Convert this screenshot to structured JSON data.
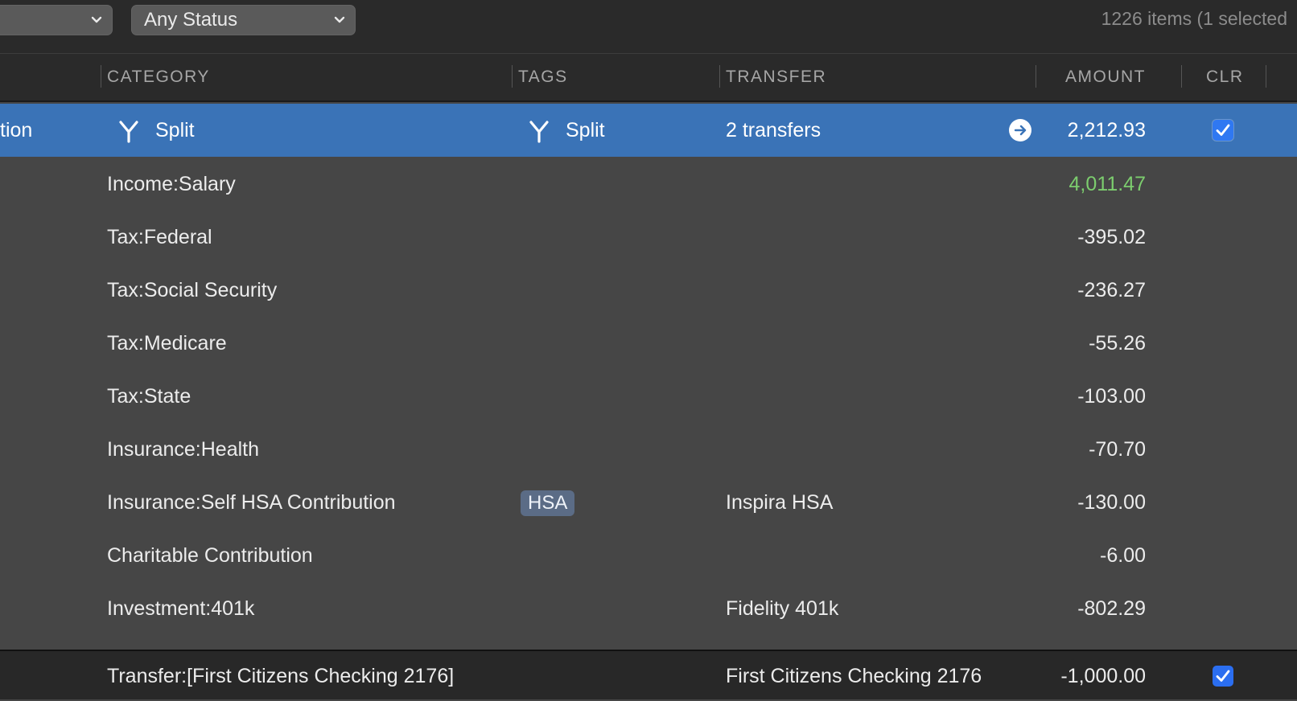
{
  "toolbar": {
    "status_filter": "Any Status",
    "items_count": "1226 items (1 selected"
  },
  "columns": {
    "category": "CATEGORY",
    "tags": "TAGS",
    "transfer": "TRANSFER",
    "amount": "AMOUNT",
    "clr": "CLR"
  },
  "selected_row": {
    "partial_text": "tion",
    "category": "Split",
    "tags": "Split",
    "transfer": "2 transfers",
    "amount": "2,212.93",
    "cleared": true
  },
  "split_rows": [
    {
      "category": "Income:Salary",
      "tag": "",
      "transfer": "",
      "amount": "4,011.47"
    },
    {
      "category": "Tax:Federal",
      "tag": "",
      "transfer": "",
      "amount": "-395.02"
    },
    {
      "category": "Tax:Social Security",
      "tag": "",
      "transfer": "",
      "amount": "-236.27"
    },
    {
      "category": "Tax:Medicare",
      "tag": "",
      "transfer": "",
      "amount": "-55.26"
    },
    {
      "category": "Tax:State",
      "tag": "",
      "transfer": "",
      "amount": "-103.00"
    },
    {
      "category": "Insurance:Health",
      "tag": "",
      "transfer": "",
      "amount": "-70.70"
    },
    {
      "category": "Insurance:Self HSA Contribution",
      "tag": "HSA",
      "transfer": "Inspira HSA",
      "amount": "-130.00"
    },
    {
      "category": "Charitable Contribution",
      "tag": "",
      "transfer": "",
      "amount": "-6.00"
    },
    {
      "category": "Investment:401k",
      "tag": "",
      "transfer": "Fidelity 401k",
      "amount": "-802.29"
    }
  ],
  "last_row": {
    "category": "Transfer:[First Citizens Checking 2176]",
    "transfer": "First Citizens Checking 2176",
    "amount": "-1,000.00",
    "cleared": true
  },
  "colors": {
    "selection": "#3a73b7",
    "positive_amount": "#7ccd6e",
    "checkbox": "#2b6ef0",
    "tag_pill": "#5b6c86"
  }
}
